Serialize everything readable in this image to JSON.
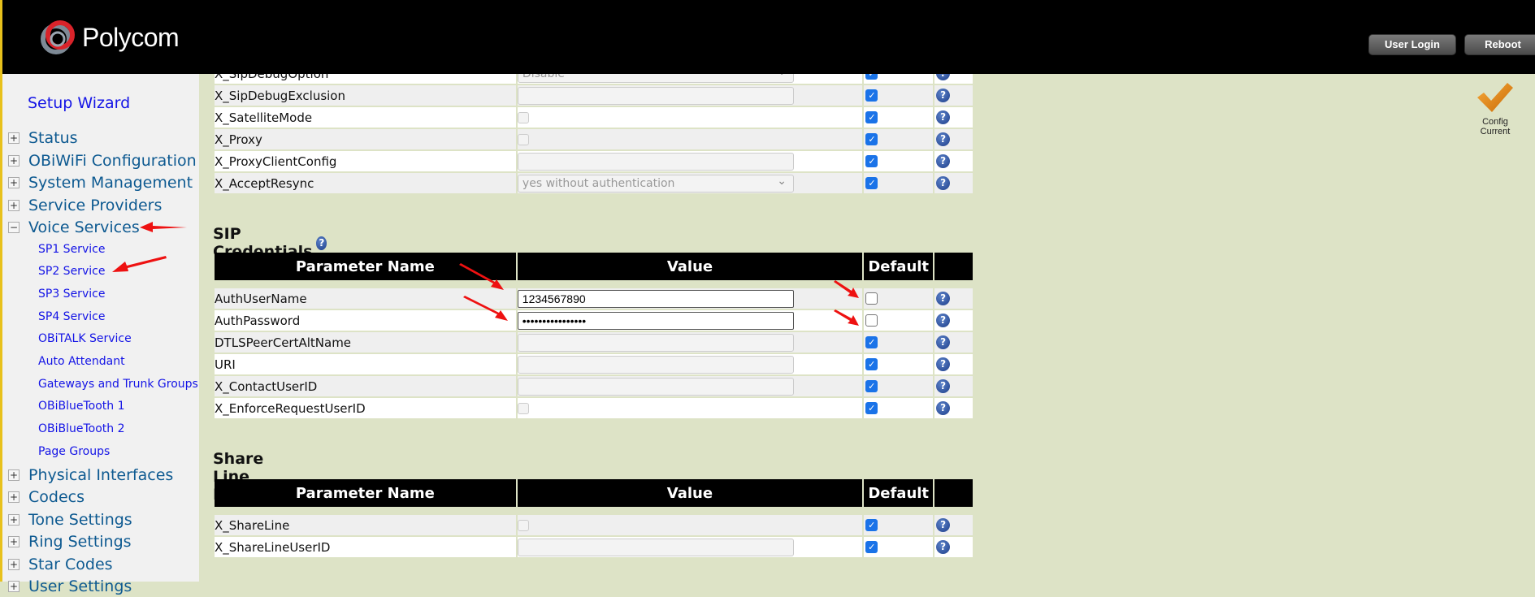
{
  "header": {
    "brand": "Polycom",
    "buttons": {
      "user_login": "User Login",
      "reboot": "Reboot"
    }
  },
  "status": {
    "config_icon": "check-mark-icon",
    "config_line1": "Config",
    "config_line2": "Current",
    "accent": "#f0a020"
  },
  "sidebar": {
    "setup_wizard": "Setup Wizard",
    "top_items_before": [
      {
        "label": "Status",
        "toggle": "+"
      },
      {
        "label": "OBiWiFi Configuration",
        "toggle": "+"
      },
      {
        "label": "System Management",
        "toggle": "+"
      },
      {
        "label": "Service Providers",
        "toggle": "+"
      },
      {
        "label": "Voice Services",
        "toggle": "−"
      }
    ],
    "voice_sub_items": [
      "SP1 Service",
      "SP2 Service",
      "SP3 Service",
      "SP4 Service",
      "OBiTALK Service",
      "Auto Attendant",
      "Gateways and Trunk Groups",
      "OBiBlueTooth 1",
      "OBiBlueTooth 2",
      "Page Groups"
    ],
    "top_items_after": [
      {
        "label": "Physical Interfaces",
        "toggle": "+"
      },
      {
        "label": "Codecs",
        "toggle": "+"
      },
      {
        "label": "Tone Settings",
        "toggle": "+"
      },
      {
        "label": "Ring Settings",
        "toggle": "+"
      },
      {
        "label": "Star Codes",
        "toggle": "+"
      },
      {
        "label": "User Settings",
        "toggle": "+"
      }
    ]
  },
  "columns": {
    "name": "Parameter Name",
    "value": "Value",
    "default": "Default"
  },
  "top_table": {
    "rows": [
      {
        "name": "X_SipDebugOption",
        "type": "select",
        "value": "Disable",
        "default": true
      },
      {
        "name": "X_SipDebugExclusion",
        "type": "text",
        "value": "",
        "default": true
      },
      {
        "name": "X_SatelliteMode",
        "type": "checkbox",
        "value": "",
        "default": true
      },
      {
        "name": "X_Proxy",
        "type": "checkbox",
        "value": "",
        "default": true
      },
      {
        "name": "X_ProxyClientConfig",
        "type": "text",
        "value": "",
        "default": true
      },
      {
        "name": "X_AcceptResync",
        "type": "select",
        "value": "yes without authentication",
        "default": true
      }
    ]
  },
  "sip_credentials": {
    "title": "SIP Credentials",
    "rows": [
      {
        "name": "AuthUserName",
        "type": "text-active",
        "value": "1234567890",
        "default": false
      },
      {
        "name": "AuthPassword",
        "type": "text-active",
        "value": "••••••••••••••••",
        "default": false
      },
      {
        "name": "DTLSPeerCertAltName",
        "type": "text",
        "value": "",
        "default": true
      },
      {
        "name": "URI",
        "type": "text",
        "value": "",
        "default": true
      },
      {
        "name": "X_ContactUserID",
        "type": "text",
        "value": "",
        "default": true
      },
      {
        "name": "X_EnforceRequestUserID",
        "type": "checkbox",
        "value": "",
        "default": true
      }
    ]
  },
  "share_line": {
    "title": "Share Line Features",
    "rows": [
      {
        "name": "X_ShareLine",
        "type": "checkbox",
        "value": "",
        "default": true
      },
      {
        "name": "X_ShareLineUserID",
        "type": "text",
        "value": "",
        "default": true
      }
    ]
  },
  "colors": {
    "annotation_arrow": "#ee1111",
    "link_blue": "#1414e6",
    "nav_blue": "#0e5a91",
    "checkbox_blue": "#1a73e8",
    "page_bg": "#dde3c6"
  }
}
